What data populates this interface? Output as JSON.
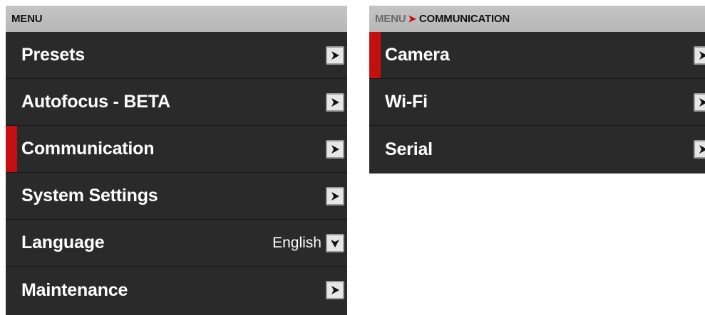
{
  "left_menu": {
    "header": "MENU",
    "items": [
      {
        "label": "Presets"
      },
      {
        "label": "Autofocus - BETA"
      },
      {
        "label": "Communication",
        "selected": true
      },
      {
        "label": "System Settings"
      },
      {
        "label": "Language",
        "value": "English"
      },
      {
        "label": "Maintenance"
      }
    ]
  },
  "right_menu": {
    "breadcrumb": {
      "root": "MENU",
      "separator": "➤",
      "current": "COMMUNICATION"
    },
    "items": [
      {
        "label": "Camera",
        "selected": true
      },
      {
        "label": "Wi-Fi"
      },
      {
        "label": "Serial"
      }
    ]
  },
  "icons": {
    "submenu": "chevron-right-icon",
    "dropdown": "chevron-down-icon"
  },
  "colors": {
    "panel_bg": "#2a2a2a",
    "header_bg": "#c4c4c4",
    "accent_red": "#c30f0f"
  }
}
